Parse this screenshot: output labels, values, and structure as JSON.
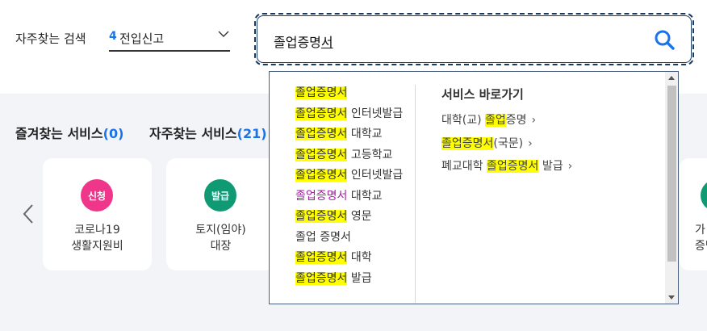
{
  "header": {
    "frequent_search_label": "자주찾는 검색",
    "frequent_select": {
      "number": "4",
      "text": "전입신고"
    }
  },
  "search": {
    "value_main": "졸업증명",
    "value_composing": "서"
  },
  "sections": {
    "favorites": {
      "label": "즐겨찾는 서비스",
      "count": "(0)"
    },
    "frequent": {
      "label": "자주찾는 서비스",
      "count": "(21)"
    }
  },
  "cards": [
    {
      "badge": "신청",
      "badge_color": "#f0368a",
      "line1": "코로나19",
      "line2": "생활지원비"
    },
    {
      "badge": "발급",
      "badge_color": "#0f9a74",
      "line1": "토지(임야)",
      "line2": "대장"
    }
  ],
  "partial_card": {
    "badge_color": "#0f9a74",
    "line1": "가",
    "line2": "증명"
  },
  "suggestions": [
    {
      "hl": "졸업증명서",
      "rest": ""
    },
    {
      "hl": "졸업증명서",
      "rest": " 인터넷발급"
    },
    {
      "hl": "졸업증명서",
      "rest": " 대학교"
    },
    {
      "hl": "졸업증명서",
      "rest": " 고등학교"
    },
    {
      "hl": "졸업증명서",
      "rest": " 인터넷발급",
      "extra_purple": "졸업증명서",
      "extra_tail": " 대학교"
    },
    {
      "hl": "졸업증명서",
      "rest": " 영문"
    },
    {
      "hl": "",
      "rest": "졸업 증명서"
    },
    {
      "hl": "졸업증명서",
      "rest": " 대학"
    },
    {
      "hl": "졸업증명서",
      "rest": " 발급"
    }
  ],
  "shortcuts": {
    "title": "서비스 바로가기",
    "items": [
      {
        "pre": "대학(교) ",
        "hl": "졸업",
        "post": "증명"
      },
      {
        "pre": "",
        "hl": "졸업증명서",
        "post": "(국문)"
      },
      {
        "pre": "폐교대학 ",
        "hl": "졸업증명서",
        "post": " 발급"
      }
    ],
    "arrow": "›"
  },
  "icons": [
    "chevron-down-icon",
    "search-icon",
    "chevron-left-icon",
    "scroll-up-icon",
    "scroll-down-icon"
  ],
  "colors": {
    "accent": "#1a73e8",
    "highlight": "#ffff00",
    "search_border": "#1a3a66"
  }
}
